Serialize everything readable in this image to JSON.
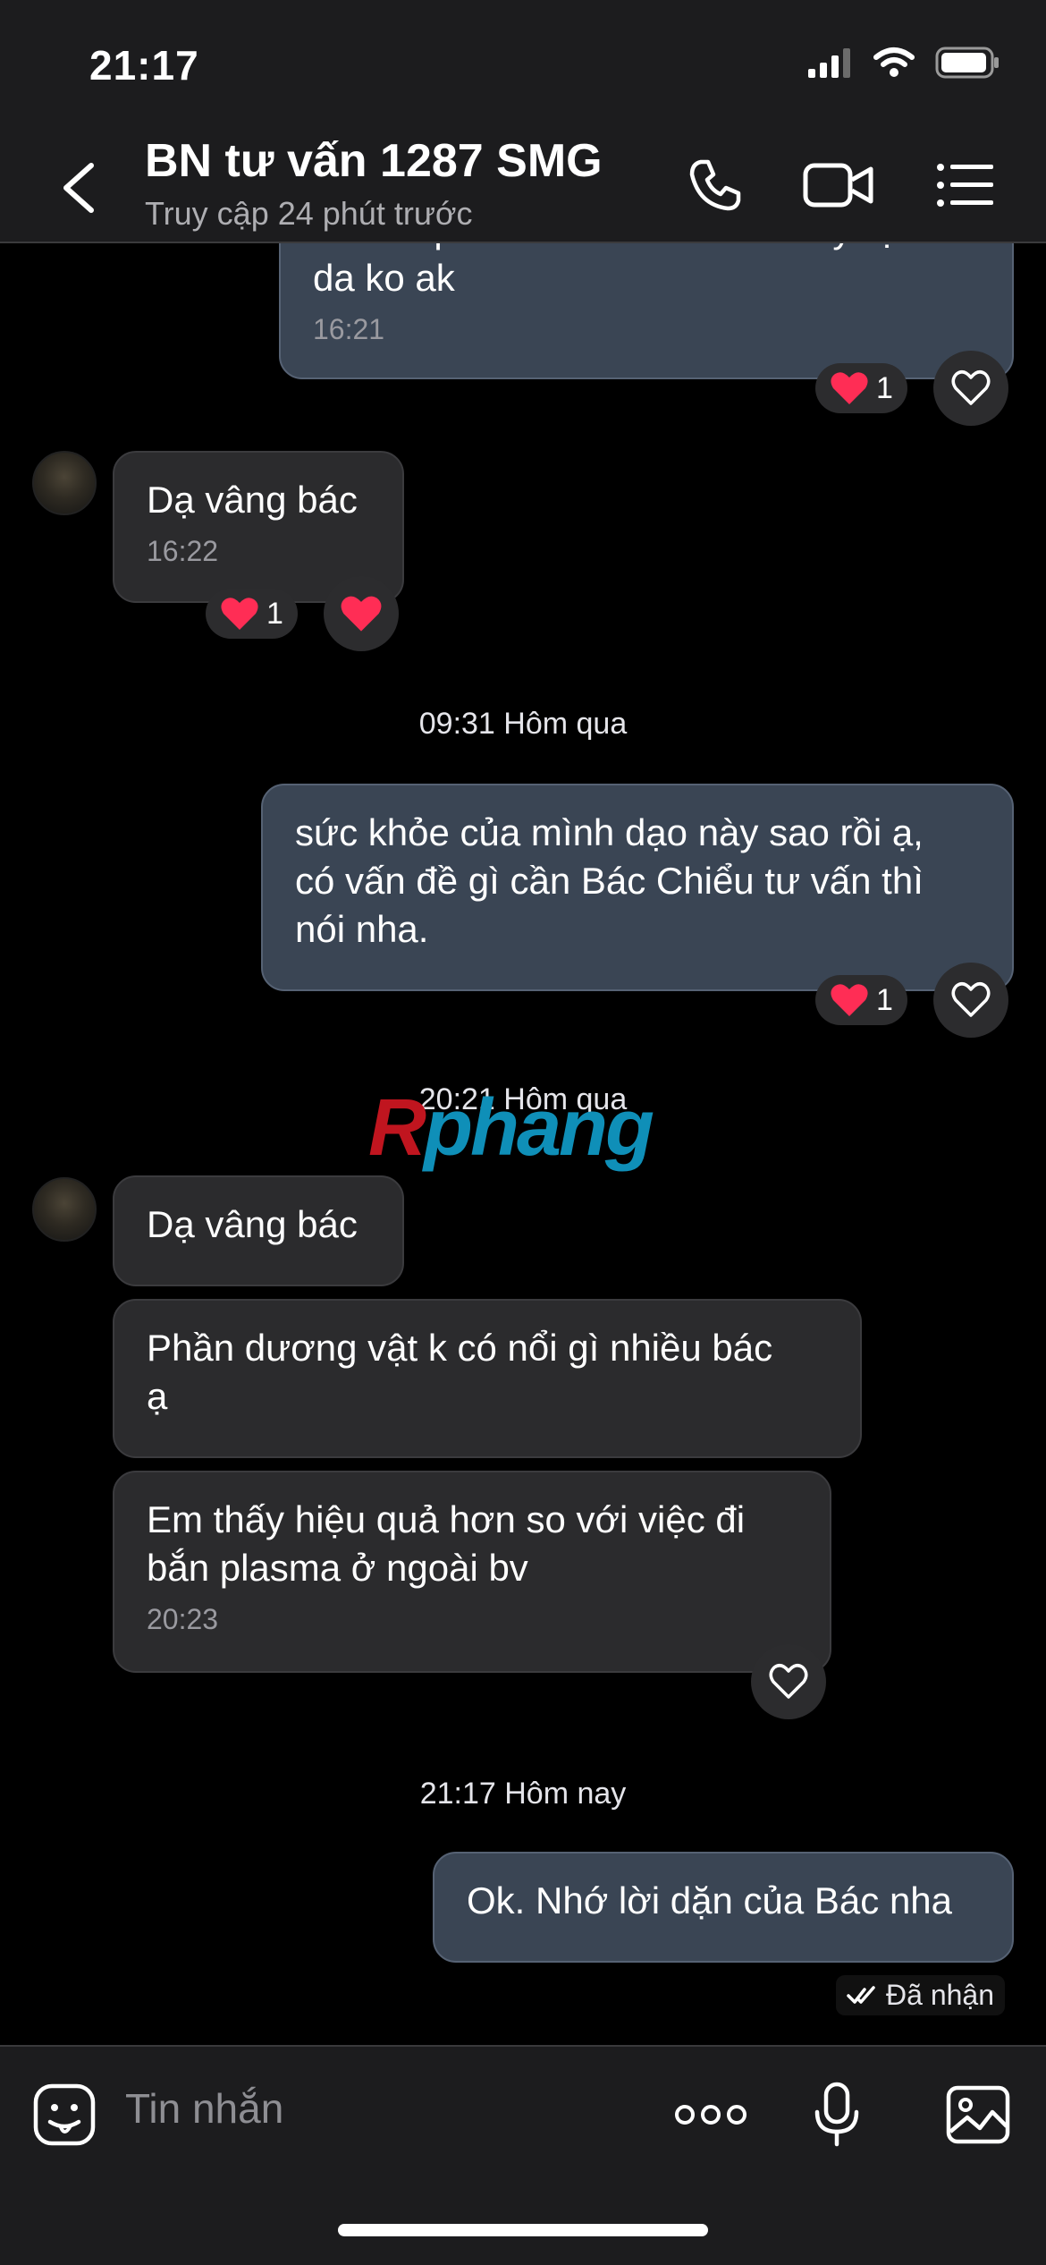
{
  "status_bar": {
    "time": "21:17"
  },
  "header": {
    "title": "BN tư vấn 1287 SMG",
    "subtitle": "Truy cập 24 phút trước"
  },
  "messages": {
    "m1": {
      "partial_text": "cho ko phải xài đó chỗ thêm này dịu",
      "text": "da ko ak",
      "time": "16:21",
      "reaction_count": "1"
    },
    "m2": {
      "text": "Dạ vâng bác",
      "time": "16:22",
      "reaction_count": "1"
    },
    "sep1": "09:31 Hôm qua",
    "m3": {
      "line1": "sức khỏe của mình dạo này sao rồi ạ,",
      "line2": "có vấn đề gì cần Bác Chiểu tư vấn thì",
      "line3": "nói nha.",
      "reaction_count": "1"
    },
    "sep2": "20:21 Hôm qua",
    "m4": {
      "text": "Dạ vâng bác"
    },
    "m5": {
      "line1": "Phần dương vật k có nổi gì nhiều bác",
      "line2": "ạ"
    },
    "m6": {
      "line1": "Em thấy hiệu quả hơn so với việc đi",
      "line2": "bắn plasma ở ngoài bv",
      "time": "20:23"
    },
    "sep3": "21:17 Hôm nay",
    "m7": {
      "text": "Ok. Nhớ lời dặn của Bác nha"
    },
    "received": "Đã nhận"
  },
  "watermark": {
    "part1": "R",
    "part2": "phang"
  },
  "composer": {
    "placeholder": "Tin nhắn"
  },
  "colors": {
    "outgoing_bubble": "#3a4554",
    "incoming_bubble": "#2b2b2d",
    "heart": "#ff2d55"
  }
}
